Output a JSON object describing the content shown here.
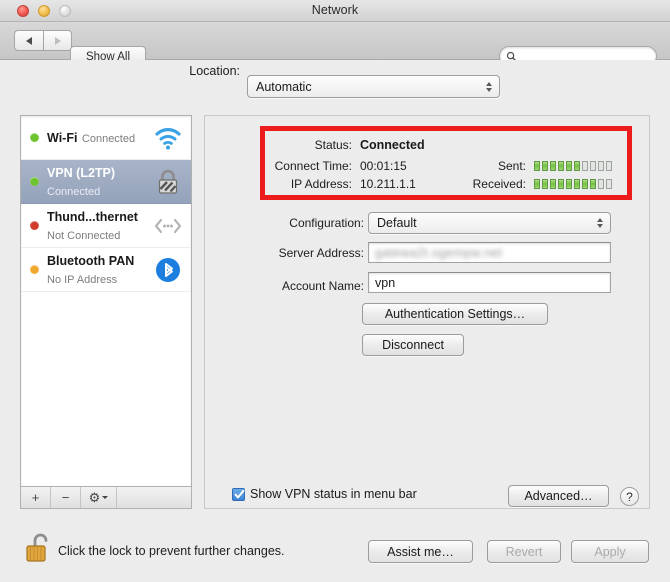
{
  "window": {
    "title": "Network",
    "traffic_lights": {
      "close": "close-button",
      "minimize": "minimize-button",
      "zoom": "zoom-button"
    }
  },
  "toolbar": {
    "back_label": "",
    "forward_label": "",
    "show_all_label": "Show All",
    "search_placeholder": "",
    "search_value": ""
  },
  "location": {
    "label": "Location:",
    "value": "Automatic"
  },
  "sidebar": {
    "services": [
      {
        "name": "Wi-Fi",
        "status": "Connected",
        "dot_color": "#6ec42e",
        "icon": "wifi-icon",
        "selected": false
      },
      {
        "name": "VPN (L2TP)",
        "status": "Connected",
        "dot_color": "#6ec42e",
        "icon": "lock-icon",
        "selected": true
      },
      {
        "name": "Thund...thernet",
        "status": "Not Connected",
        "dot_color": "#d03b2c",
        "icon": "ethernet-icon",
        "selected": false
      },
      {
        "name": "Bluetooth PAN",
        "status": "No IP Address",
        "dot_color": "#f0a92e",
        "icon": "bluetooth-icon",
        "selected": false
      }
    ],
    "toolbar": {
      "add_label": "+",
      "remove_label": "−",
      "action_label": "⚙"
    }
  },
  "detail": {
    "status": {
      "status_label": "Status:",
      "status_value": "Connected",
      "connect_time_label": "Connect Time:",
      "connect_time_value": "00:01:15",
      "ip_address_label": "IP Address:",
      "ip_address_value": "10.211.1.1",
      "sent_label": "Sent:",
      "sent_segments_total": 10,
      "sent_segments_lit": 6,
      "received_label": "Received:",
      "received_segments_total": 10,
      "received_segments_lit": 8,
      "highlight_color": "#ed1c1c"
    },
    "configuration_label": "Configuration:",
    "configuration_value": "Default",
    "server_address_label": "Server Address:",
    "server_address_value": "gatewa2t.ogempw.net",
    "account_name_label": "Account Name:",
    "account_name_value": "vpn",
    "auth_settings_label": "Authentication Settings…",
    "disconnect_label": "Disconnect",
    "show_status_label": "Show VPN status in menu bar",
    "show_status_checked": true,
    "advanced_label": "Advanced…",
    "help_label": "?"
  },
  "bottom": {
    "lock_text": "Click the lock to prevent further changes.",
    "assist_label": "Assist me…",
    "revert_label": "Revert",
    "apply_label": "Apply"
  }
}
